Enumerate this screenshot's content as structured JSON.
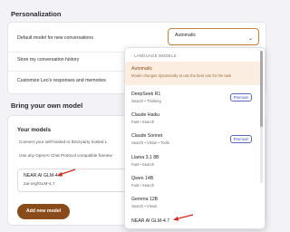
{
  "personalization": {
    "title": "Personalization",
    "default_model_label": "Default model for new conversations",
    "default_model_value": "Automatic",
    "store_history_label": "Store my conversation history",
    "customize_label": "Customize Leo's responses and memories"
  },
  "byom": {
    "title": "Bring your own model",
    "your_models_title": "Your models",
    "desc1": "Connect your self-hosted or third-party hosted L",
    "desc2": "Use any OpenAI Chat Protocol compatible framew",
    "model_name": "NEAR AI GLM-4.7",
    "model_id": "zai-org/GLM-4.7",
    "add_button": "Add new model"
  },
  "dropdown": {
    "heading": "LANGUAGE MODELS",
    "options": [
      {
        "name": "Automatic",
        "sub": "Model changes dynamically to use the best one for the task",
        "badge": "",
        "selected": true
      },
      {
        "name": "DeepSeek R1",
        "sub": "Search • Thinking",
        "badge": "Premium"
      },
      {
        "name": "Claude Haiku",
        "sub": "Fast • Search",
        "badge": ""
      },
      {
        "name": "Claude Sonnet",
        "sub": "Search • Vision • Tools",
        "badge": "Premium"
      },
      {
        "name": "Llama 3.1 8B",
        "sub": "Fast • Search",
        "badge": ""
      },
      {
        "name": "Qwen 14B",
        "sub": "Fast • Search",
        "badge": ""
      },
      {
        "name": "Gemma 12B",
        "sub": "Search • Vision",
        "badge": ""
      },
      {
        "name": "NEAR AI GLM-4.7",
        "sub": "",
        "badge": ""
      }
    ]
  },
  "colors": {
    "accent": "#8a4b1b",
    "select_border": "#c9863a",
    "annotation_arrow": "#d9281f"
  },
  "icons": {
    "select_chevron": "chevron-down-icon",
    "arrow": "red-arrow-icon"
  }
}
